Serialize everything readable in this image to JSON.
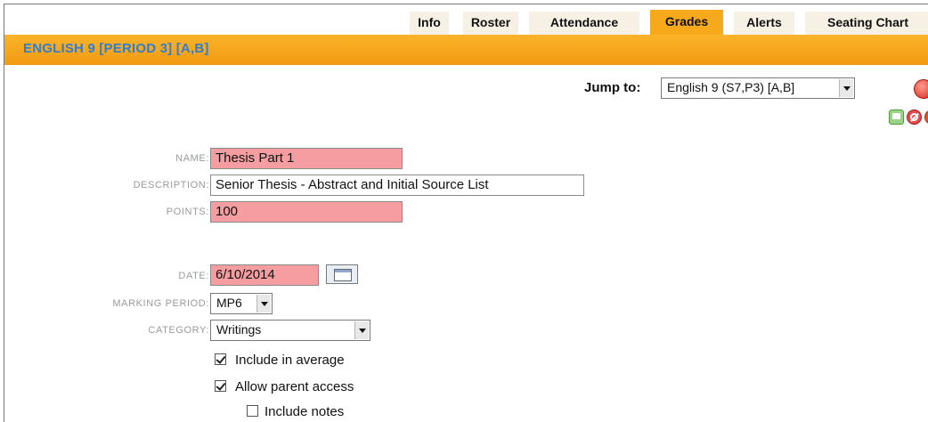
{
  "tabs": [
    {
      "label": "Info",
      "active": false
    },
    {
      "label": "Roster",
      "active": false
    },
    {
      "label": "Attendance",
      "active": false
    },
    {
      "label": "Grades",
      "active": true
    },
    {
      "label": "Alerts",
      "active": false
    },
    {
      "label": "Seating Chart",
      "active": false
    }
  ],
  "section": {
    "title": "ENGLISH 9 [PERIOD 3] [A,B]"
  },
  "jump": {
    "label": "Jump to:",
    "selected": "English 9 (S7,P3) [A,B]"
  },
  "form": {
    "name": {
      "label": "NAME:",
      "value": "Thesis Part 1"
    },
    "description": {
      "label": "DESCRIPTION:",
      "value": "Senior Thesis - Abstract and Initial Source List"
    },
    "points": {
      "label": "POINTS:",
      "value": "100"
    },
    "date": {
      "label": "DATE:",
      "value": "6/10/2014"
    },
    "marking_period": {
      "label": "MARKING PERIOD:",
      "value": "MP6"
    },
    "category": {
      "label": "CATEGORY:",
      "value": "Writings"
    },
    "include_average": {
      "label": "Include in average",
      "checked": true
    },
    "allow_parent": {
      "label": "Allow parent access",
      "checked": true
    },
    "include_notes": {
      "label": "Include notes",
      "checked": false
    }
  },
  "icons": {
    "save": "save-icon",
    "cancel": "cancel-icon",
    "delete": "delete-icon",
    "jump_go": "go-icon",
    "calendar": "calendar-icon"
  },
  "colors": {
    "accent": "#f5a91b",
    "required": "#f59da0",
    "title": "#2f7fd1"
  }
}
